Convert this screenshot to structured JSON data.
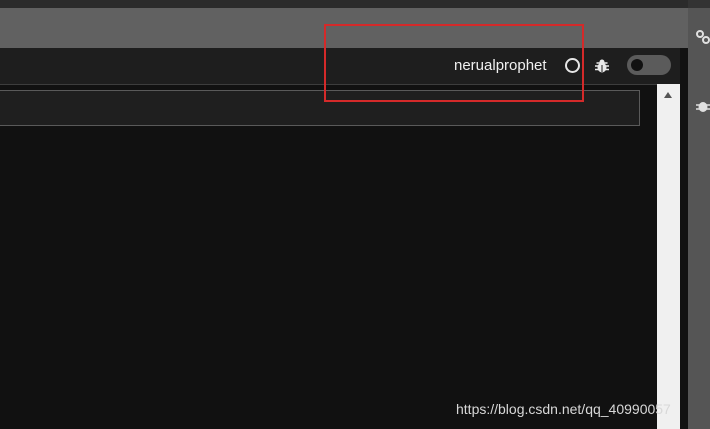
{
  "toolbar": {
    "kernel_name": "nerualprophet",
    "kernel_status": "idle",
    "debugger_toggle": "off"
  },
  "icons": {
    "kernel_status": "circle-outline-icon",
    "debug": "bug-icon",
    "right_panel": [
      "gears-icon",
      "bug-icon"
    ]
  },
  "colors": {
    "background": "#111111",
    "toolbar": "#1e1e1e",
    "highlight": "#d42a2a"
  },
  "watermark": "https://blog.csdn.net/qq_40990057"
}
